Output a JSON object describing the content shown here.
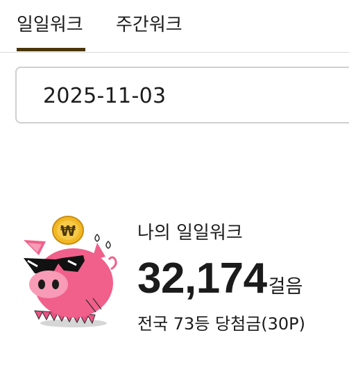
{
  "tabs": [
    {
      "label": "일일워크",
      "selected": true
    },
    {
      "label": "주간워크",
      "selected": false
    }
  ],
  "date_field": {
    "value": "2025-11-03"
  },
  "summary": {
    "title": "나의 일일워크",
    "steps": "32,174",
    "steps_unit": "걸음",
    "rank_text": "전국 73등 당첨금(30P)"
  },
  "mascot": {
    "icon": "piggy-bank-coin-icon",
    "coin_symbol": "₩"
  },
  "colors": {
    "tab_indicator": "#4a3608",
    "pig_pink": "#f0608a",
    "coin_gold": "#f2b823"
  }
}
